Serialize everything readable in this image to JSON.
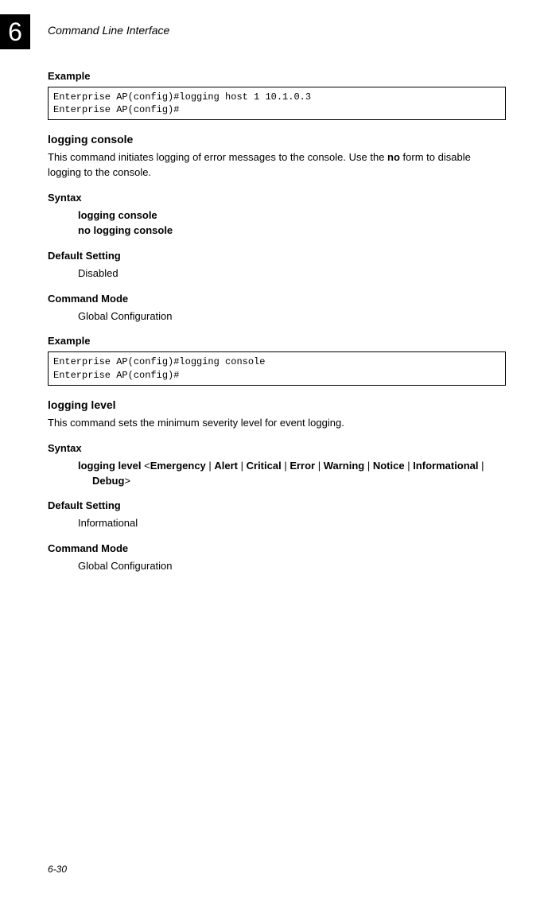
{
  "chapter": {
    "number": "6",
    "title": "Command Line Interface"
  },
  "section1": {
    "heading": "Example",
    "code": "Enterprise AP(config)#logging host 1 10.1.0.3\nEnterprise AP(config)#"
  },
  "cmd1": {
    "name": "logging console",
    "desc_pre": "This command initiates logging of error messages to the console. Use the ",
    "desc_bold": "no",
    "desc_post": " form to disable logging to the console.",
    "syntax_label": "Syntax",
    "syntax_line1": "logging console",
    "syntax_line2": "no logging console",
    "default_label": "Default Setting",
    "default_value": "Disabled",
    "mode_label": "Command Mode",
    "mode_value": "Global Configuration",
    "example_label": "Example",
    "code": "Enterprise AP(config)#logging console\nEnterprise AP(config)#"
  },
  "cmd2": {
    "name": "logging level",
    "desc": "This command sets the minimum severity level for event logging.",
    "syntax_label": "Syntax",
    "syntax_pre": "logging level",
    "syntax_lt": " <",
    "op1": "Emergency",
    "op2": "Alert",
    "op3": "Critical",
    "op4": "Error",
    "op5": "Warning",
    "op6": "Notice",
    "op7": "Informational",
    "op8": "Debug",
    "syntax_gt": ">",
    "pipe": " | ",
    "default_label": "Default Setting",
    "default_value": "Informational",
    "mode_label": "Command Mode",
    "mode_value": "Global Configuration"
  },
  "page_number": "6-30"
}
